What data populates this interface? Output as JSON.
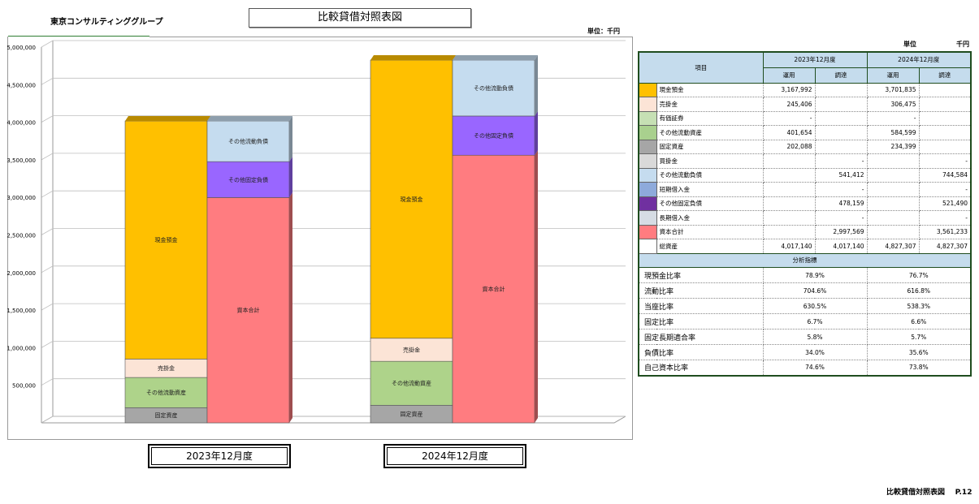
{
  "header": {
    "company": "東京コンサルティンググループ",
    "title": "比較貸借対照表図",
    "unit_left": "単位：千円",
    "unit_right_label": "単位",
    "unit_right_value": "千円"
  },
  "chart_data": {
    "type": "bar",
    "stacked": true,
    "categories": [
      "2023年12月度",
      "2024年12月度"
    ],
    "y_ticks": [
      "5,000,000",
      "4,500,000",
      "4,000,000",
      "3,500,000",
      "3,000,000",
      "2,500,000",
      "2,000,000",
      "1,500,000",
      "1,000,000",
      "500,000"
    ],
    "ylim": [
      0,
      5000000
    ],
    "columns": [
      {
        "side": "assets",
        "name": "運用",
        "series": [
          {
            "name": "固定資産",
            "values": [
              202088,
              234399
            ],
            "color": "#a6a6a6"
          },
          {
            "name": "その他流動資産",
            "values": [
              401654,
              584599
            ],
            "color": "#aed38a"
          },
          {
            "name": "売掛金",
            "values": [
              245406,
              306475
            ],
            "color": "#fce4d6"
          },
          {
            "name": "現金預金",
            "values": [
              3167992,
              3701835
            ],
            "color": "#ffc000"
          }
        ]
      },
      {
        "side": "liabilities",
        "name": "調達",
        "series": [
          {
            "name": "資本合計",
            "values": [
              2997569,
              3561233
            ],
            "color": "#ff7c80"
          },
          {
            "name": "その他固定負債",
            "values": [
              478159,
              521490
            ],
            "color": "#9966ff"
          },
          {
            "name": "その他流動負債",
            "values": [
              541412,
              744584
            ],
            "color": "#c5dcef"
          }
        ]
      }
    ]
  },
  "table": {
    "item_header": "項目",
    "periods": [
      "2023年12月度",
      "2024年12月度"
    ],
    "sub_headers": [
      "運用",
      "調達",
      "運用",
      "調達"
    ],
    "rows": [
      {
        "label": "現金預金",
        "color": "#ffc000",
        "v": [
          "3,167,992",
          "",
          "3,701,835",
          ""
        ]
      },
      {
        "label": "売掛金",
        "color": "#fce4d6",
        "v": [
          "245,406",
          "",
          "306,475",
          ""
        ]
      },
      {
        "label": "有価証券",
        "color": "#c6e0b4",
        "v": [
          "-",
          "",
          "-",
          ""
        ]
      },
      {
        "label": "その他流動資産",
        "color": "#a9d08e",
        "v": [
          "401,654",
          "",
          "584,599",
          ""
        ]
      },
      {
        "label": "固定資産",
        "color": "#a6a6a6",
        "v": [
          "202,088",
          "",
          "234,399",
          ""
        ]
      },
      {
        "label": "買掛金",
        "color": "#d9d9d9",
        "v": [
          "",
          "-",
          "",
          "-"
        ]
      },
      {
        "label": "その他流動負債",
        "color": "#c5dcef",
        "v": [
          "",
          "541,412",
          "",
          "744,584"
        ]
      },
      {
        "label": "短期借入金",
        "color": "#8eaadb",
        "v": [
          "",
          "-",
          "",
          "-"
        ]
      },
      {
        "label": "その他固定負債",
        "color": "#7030a0",
        "v": [
          "",
          "478,159",
          "",
          "521,490"
        ]
      },
      {
        "label": "長期借入金",
        "color": "#d6dce4",
        "v": [
          "",
          "-",
          "",
          "-"
        ]
      },
      {
        "label": "資本合計",
        "color": "#ff7c80",
        "v": [
          "",
          "2,997,569",
          "",
          "3,561,233"
        ]
      },
      {
        "label": "総資産",
        "color": "#ffffff",
        "v": [
          "4,017,140",
          "4,017,140",
          "4,827,307",
          "4,827,307"
        ]
      }
    ],
    "analysis_header": "分析指標",
    "ratios": [
      {
        "label": "現預金比率",
        "v": [
          "78.9%",
          "76.7%"
        ]
      },
      {
        "label": "流動比率",
        "v": [
          "704.6%",
          "616.8%"
        ]
      },
      {
        "label": "当座比率",
        "v": [
          "630.5%",
          "538.3%"
        ]
      },
      {
        "label": "固定比率",
        "v": [
          "6.7%",
          "6.6%"
        ]
      },
      {
        "label": "固定長期適合率",
        "v": [
          "5.8%",
          "5.7%"
        ]
      },
      {
        "label": "負債比率",
        "v": [
          "34.0%",
          "35.6%"
        ]
      },
      {
        "label": "自己資本比率",
        "v": [
          "74.6%",
          "73.8%"
        ]
      }
    ]
  },
  "footer": {
    "title": "比較貸借対照表図",
    "page": "P.12"
  }
}
